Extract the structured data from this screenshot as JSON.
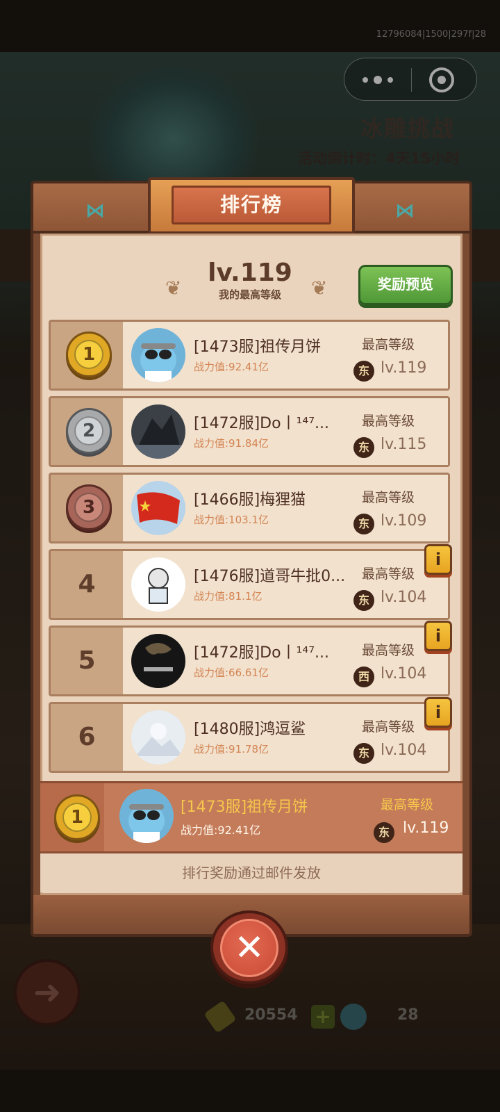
{
  "status_bar": {
    "text": "12796084|1500|297f|28"
  },
  "capsule": {
    "more_icon": "more-dots-icon",
    "close_icon": "target-circle-icon"
  },
  "event": {
    "title": "冰雕挑战",
    "countdown": "活动倒计时：4天15小时"
  },
  "modal": {
    "title": "排行榜",
    "my_best_level": "lv.119",
    "my_best_label": "我的最高等级",
    "reward_preview": "奖励预览",
    "mail_note": "排行奖励通过邮件发放"
  },
  "rankings": [
    {
      "rank": "1",
      "name": "[1473服]祖传月饼",
      "power": "战力值:92.41亿",
      "best_label": "最高等级",
      "region": "东",
      "level": "lv.119",
      "info": false
    },
    {
      "rank": "2",
      "name": "[1472服]Do丨¹⁴⁷...",
      "power": "战力值:91.84亿",
      "best_label": "最高等级",
      "region": "东",
      "level": "lv.115",
      "info": false
    },
    {
      "rank": "3",
      "name": "[1466服]梅狸猫",
      "power": "战力值:103.1亿",
      "best_label": "最高等级",
      "region": "东",
      "level": "lv.109",
      "info": false
    },
    {
      "rank": "4",
      "name": "[1476服]道哥牛批0...",
      "power": "战力值:81.1亿",
      "best_label": "最高等级",
      "region": "东",
      "level": "lv.104",
      "info": true
    },
    {
      "rank": "5",
      "name": "[1472服]Do丨¹⁴⁷...",
      "power": "战力值:66.61亿",
      "best_label": "最高等级",
      "region": "西",
      "level": "lv.104",
      "info": true
    },
    {
      "rank": "6",
      "name": "[1480服]鸿逗鲨",
      "power": "战力值:91.78亿",
      "best_label": "最高等级",
      "region": "东",
      "level": "lv.104",
      "info": true
    }
  ],
  "my_row": {
    "rank": "1",
    "name": "[1473服]祖传月饼",
    "power": "战力值:92.41亿",
    "best_label": "最高等级",
    "region": "东",
    "level": "lv.119"
  },
  "bottom_bar": {
    "bones": "20554",
    "gems": "28"
  },
  "colors": {
    "accent_green": "#5aa63d",
    "panel": "#ead4bd",
    "frame": "#7a4a31"
  }
}
